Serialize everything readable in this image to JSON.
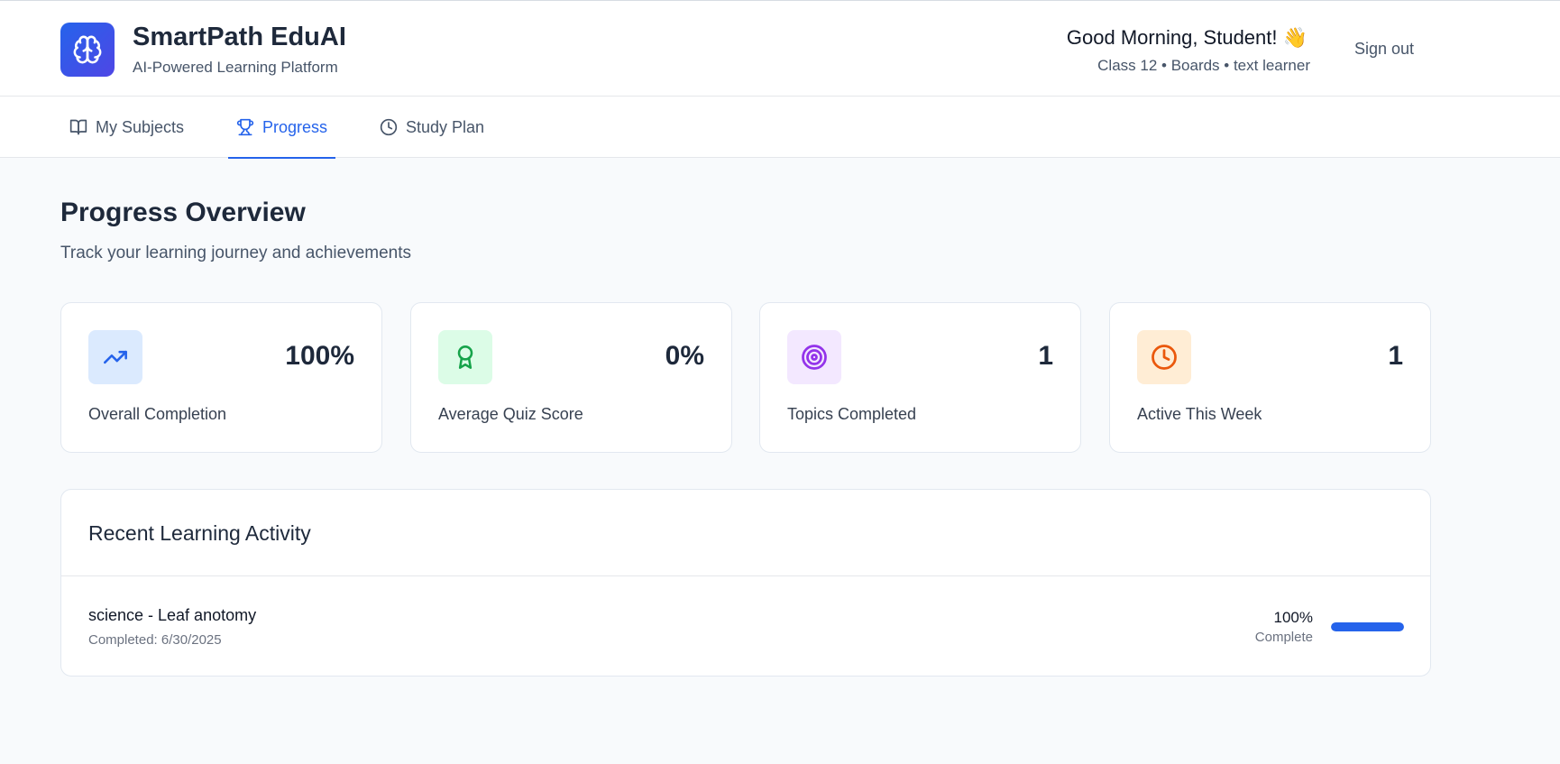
{
  "header": {
    "app_title": "SmartPath EduAI",
    "app_subtitle": "AI-Powered Learning Platform",
    "greeting": "Good Morning, Student! 👋",
    "profile_line": "Class 12 • Boards • text learner",
    "signout_label": "Sign out",
    "logo_icon": "brain-icon"
  },
  "tabs": [
    {
      "label": "My Subjects",
      "icon": "book-open-icon",
      "active": false
    },
    {
      "label": "Progress",
      "icon": "trophy-icon",
      "active": true
    },
    {
      "label": "Study Plan",
      "icon": "clock-icon",
      "active": false
    }
  ],
  "page": {
    "title": "Progress Overview",
    "subtitle": "Track your learning journey and achievements"
  },
  "stats": [
    {
      "value": "100%",
      "label": "Overall Completion",
      "icon": "trending-up-icon",
      "icon_color": "#2563eb",
      "icon_bg": "#dbeafe"
    },
    {
      "value": "0%",
      "label": "Average Quiz Score",
      "icon": "award-icon",
      "icon_color": "#16a34a",
      "icon_bg": "#dcfce7"
    },
    {
      "value": "1",
      "label": "Topics Completed",
      "icon": "target-icon",
      "icon_color": "#9333ea",
      "icon_bg": "#f3e8ff"
    },
    {
      "value": "1",
      "label": "Active This Week",
      "icon": "clock-icon",
      "icon_color": "#ea580c",
      "icon_bg": "#ffedd5"
    }
  ],
  "activity": {
    "title": "Recent Learning Activity",
    "items": [
      {
        "title": "science - Leaf anotomy",
        "date": "Completed: 6/30/2025",
        "percent": "100%",
        "status": "Complete",
        "progress": 1.0
      }
    ]
  },
  "colors": {
    "accent": "#2563eb",
    "background": "#f8fafc",
    "card_border": "#e2e8f0"
  }
}
